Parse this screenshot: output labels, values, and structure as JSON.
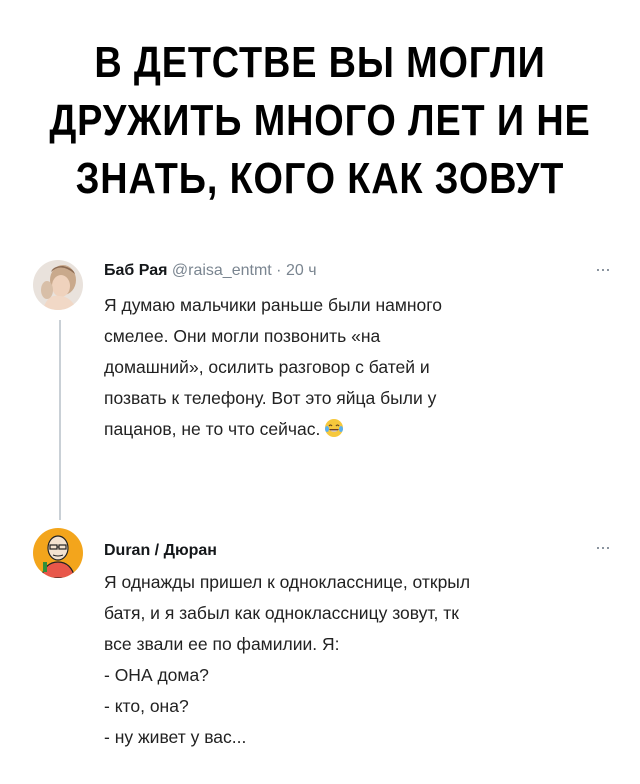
{
  "headline": {
    "lines": [
      "В ДЕТСТВЕ ВЫ МОГЛИ",
      "ДРУЖИТЬ МНОГО ЛЕТ И НЕ",
      "ЗНАТЬ, КОГО КАК ЗОВУТ"
    ]
  },
  "tweets": [
    {
      "author": "Баб Рая",
      "handle": "@raisa_entmt",
      "separator": "·",
      "time": "20 ч",
      "more": "···",
      "avatar_icon": "woman-photo-avatar",
      "text_lines": [
        "Я думаю мальчики раньше были намного",
        "смелее. Они могли позвонить «на",
        "домашний», осилить разговор с батей и",
        "позвать к телефону. Вот это яйца были у",
        "пацанов, не то что сейчас."
      ],
      "emoji": "tears-of-joy-emoji"
    },
    {
      "author": "Duran / Дюран",
      "more": "···",
      "avatar_icon": "man-cartoon-avatar",
      "text_lines": [
        "Я однажды пришел к однокласснице, открыл",
        "батя, и я забыл как одноклассницу зовут, тк",
        "все звали ее по фамилии. Я:",
        "- ОНА дома?",
        "- кто, она?",
        "- ну живет у вас..."
      ]
    }
  ],
  "colors": {
    "text": "#222222",
    "muted": "#7a8590",
    "thread_line": "#c9d0d6",
    "avatar_2_bg": "#f3a51c"
  }
}
